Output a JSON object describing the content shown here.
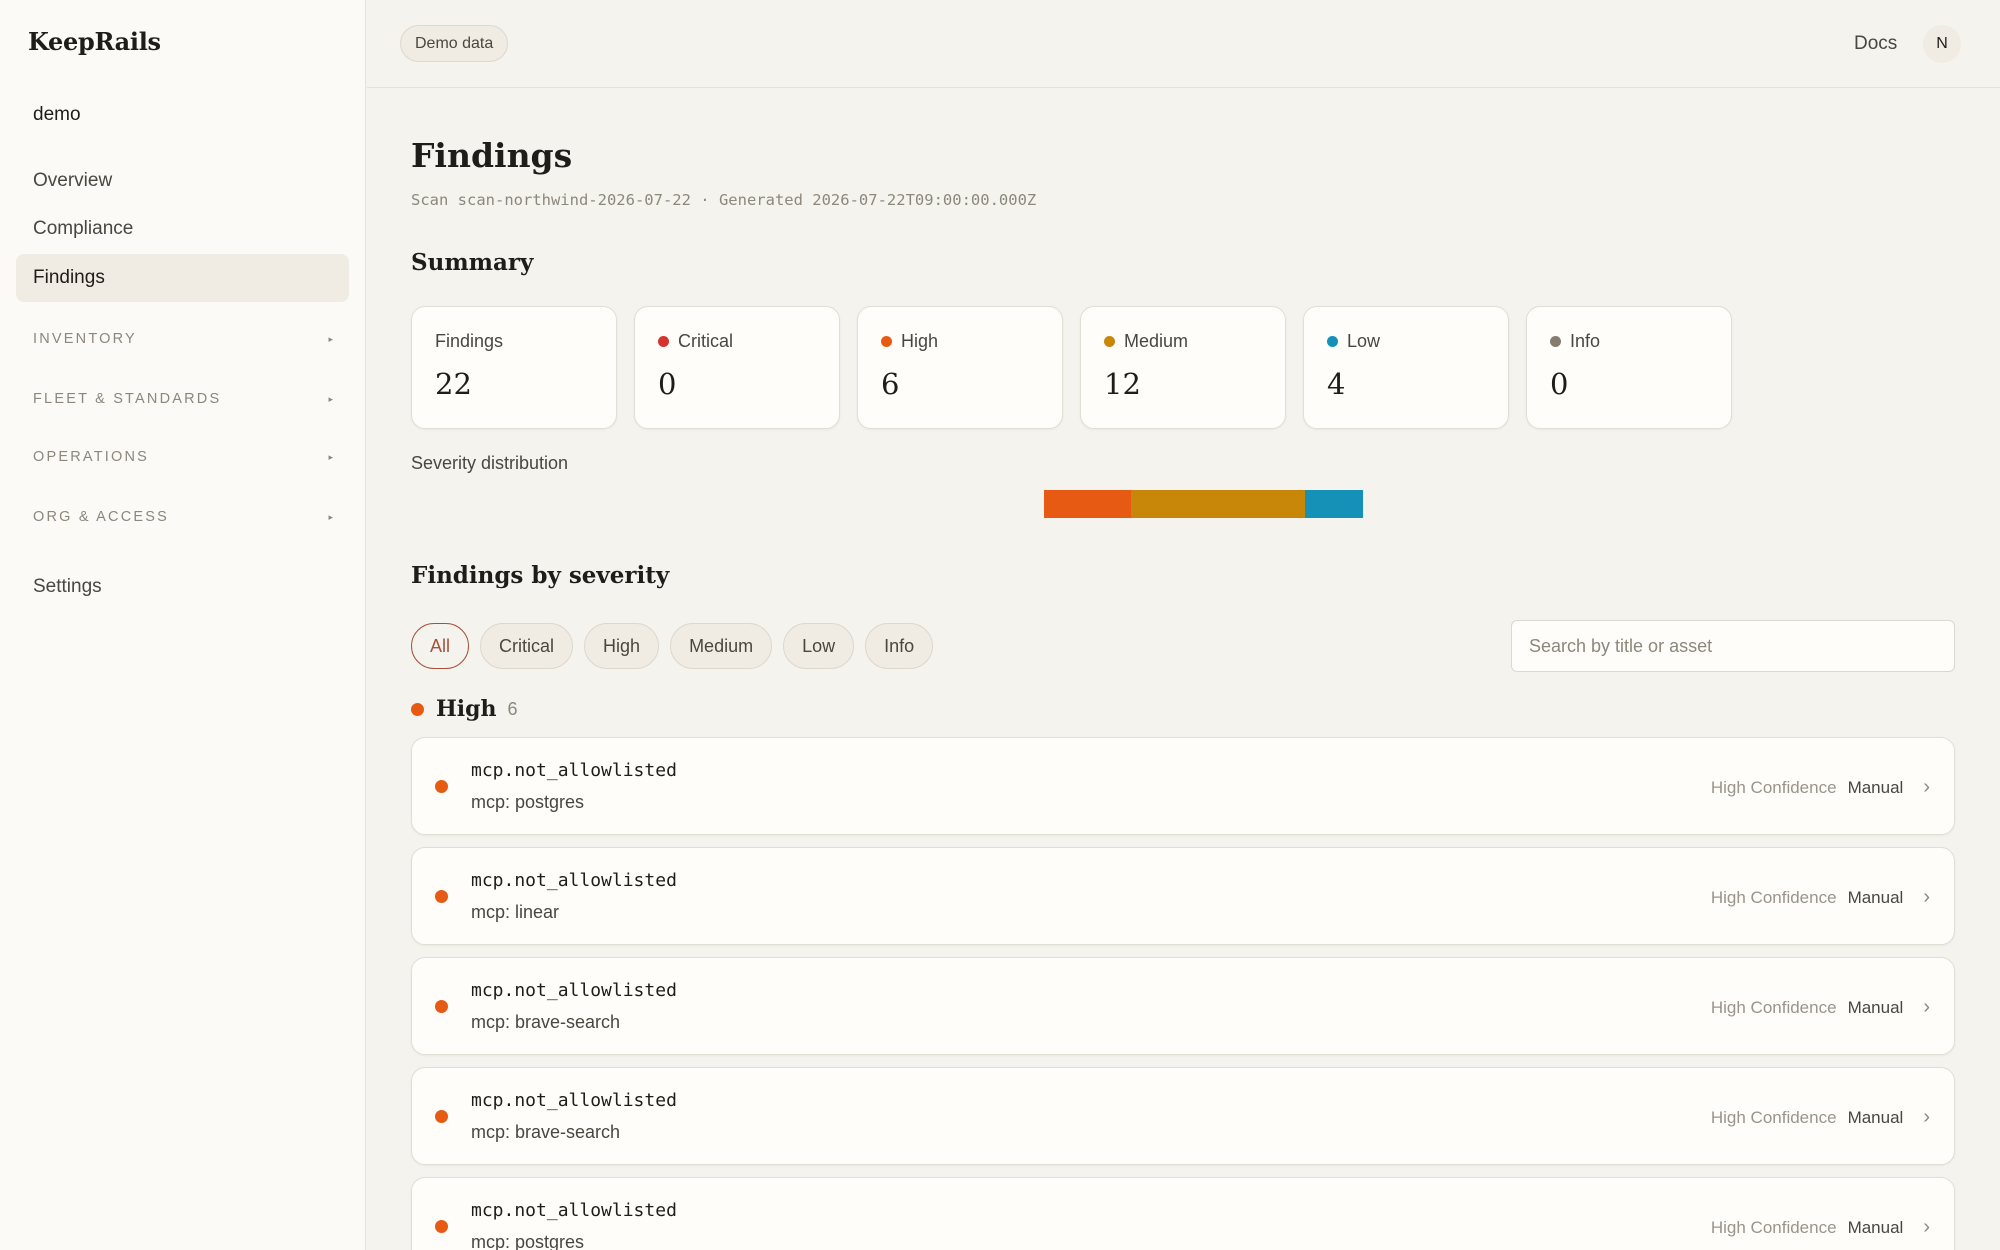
{
  "app": {
    "brand": "KeepRails",
    "workspace": "demo"
  },
  "sidebar": {
    "items": [
      {
        "label": "Overview"
      },
      {
        "label": "Compliance"
      },
      {
        "label": "Findings"
      }
    ],
    "groups": [
      {
        "label": "INVENTORY"
      },
      {
        "label": "FLEET & STANDARDS"
      },
      {
        "label": "OPERATIONS"
      },
      {
        "label": "ORG & ACCESS"
      }
    ],
    "settings_label": "Settings",
    "active_item": "Findings"
  },
  "topbar": {
    "demo_label": "Demo data",
    "docs_label": "Docs",
    "avatar_initial": "N"
  },
  "page": {
    "title": "Findings",
    "subline": "Scan scan-northwind-2026-07-22 · Generated 2026-07-22T09:00:00.000Z",
    "summary_title": "Summary",
    "dist_label": "Severity distribution",
    "by_severity_title": "Findings by severity"
  },
  "summary": {
    "cards": [
      {
        "label": "Findings",
        "value": "22",
        "color": ""
      },
      {
        "label": "Critical",
        "value": "0",
        "color": "#d6322e"
      },
      {
        "label": "High",
        "value": "6",
        "color": "#e65a14"
      },
      {
        "label": "Medium",
        "value": "12",
        "color": "#c9870a"
      },
      {
        "label": "Low",
        "value": "4",
        "color": "#1591b8"
      },
      {
        "label": "Info",
        "value": "0",
        "color": "#857c70"
      }
    ]
  },
  "distribution": [
    {
      "severity": "High",
      "count": 6,
      "color": "#e65a14"
    },
    {
      "severity": "Medium",
      "count": 12,
      "color": "#c9870a"
    },
    {
      "severity": "Low",
      "count": 4,
      "color": "#1591b8"
    }
  ],
  "filters": {
    "chips": [
      {
        "label": "All",
        "active": true
      },
      {
        "label": "Critical",
        "active": false
      },
      {
        "label": "High",
        "active": false
      },
      {
        "label": "Medium",
        "active": false
      },
      {
        "label": "Low",
        "active": false
      },
      {
        "label": "Info",
        "active": false
      }
    ],
    "search_placeholder": "Search by title or asset",
    "search_value": ""
  },
  "groups": {
    "high": {
      "label": "High",
      "count": "6",
      "color": "#e65a14",
      "rows": [
        {
          "title": "mcp.not_allowlisted",
          "asset": "mcp: postgres",
          "confidence": "High Confidence",
          "fix": "Manual"
        },
        {
          "title": "mcp.not_allowlisted",
          "asset": "mcp: linear",
          "confidence": "High Confidence",
          "fix": "Manual"
        },
        {
          "title": "mcp.not_allowlisted",
          "asset": "mcp: brave-search",
          "confidence": "High Confidence",
          "fix": "Manual"
        },
        {
          "title": "mcp.not_allowlisted",
          "asset": "mcp: brave-search",
          "confidence": "High Confidence",
          "fix": "Manual"
        },
        {
          "title": "mcp.not_allowlisted",
          "asset": "mcp: postgres",
          "confidence": "High Confidence",
          "fix": "Manual"
        }
      ]
    }
  },
  "icons": {
    "group_caret": "caret-right-icon",
    "row_chevron": "chevron-right-icon"
  }
}
